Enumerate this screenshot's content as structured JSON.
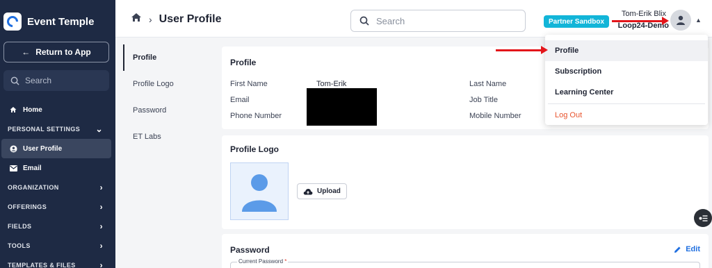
{
  "brand": {
    "name": "Event Temple"
  },
  "sidebar": {
    "return_label": "Return to App",
    "search_placeholder": "Search",
    "home_label": "Home",
    "personal_settings": "PERSONAL SETTINGS",
    "user_profile": "User Profile",
    "email": "Email",
    "sections": [
      "ORGANIZATION",
      "OFFERINGS",
      "FIELDS",
      "TOOLS",
      "TEMPLATES & FILES"
    ]
  },
  "header": {
    "page_title": "User Profile",
    "search_placeholder": "Search",
    "sandbox_badge": "Partner Sandbox",
    "user_name": "Tom-Erik Blix",
    "user_org": "Loop24-Demo"
  },
  "subnav": [
    "Profile",
    "Profile Logo",
    "Password",
    "ET Labs"
  ],
  "profile_card": {
    "title": "Profile",
    "first_name_label": "First Name",
    "first_name_value": "Tom-Erik",
    "email_label": "Email",
    "phone_label": "Phone Number",
    "last_name_label": "Last Name",
    "job_title_label": "Job Title",
    "mobile_label": "Mobile Number"
  },
  "logo_card": {
    "title": "Profile Logo",
    "upload_label": "Upload"
  },
  "password_card": {
    "title": "Password",
    "edit_label": "Edit",
    "current_password_label": "Current Password",
    "required_mark": "*"
  },
  "dropdown": {
    "items": [
      "Profile",
      "Subscription",
      "Learning Center"
    ],
    "logout": "Log Out"
  },
  "colors": {
    "sidebar_bg": "#1e2a44",
    "accent": "#1f6fe0",
    "badge": "#12b5d8",
    "logout": "#e8532d",
    "annotation_arrow": "#e3151a"
  }
}
